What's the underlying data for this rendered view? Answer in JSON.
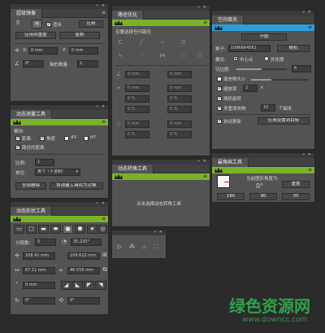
{
  "theme": {
    "accent_green": "#7cb22a",
    "accent_blue": "#2aa0d8",
    "panel_bg": "#535353"
  },
  "align_panel": {
    "title": "超级镜像",
    "checkbox_label": "适合",
    "apply_label": "应用",
    "btn_reset": "应用到重置",
    "btn_copy": "复制",
    "x_label": "X:",
    "x_value": "0 mm",
    "y_label": "Y:",
    "y_value": "0 mm",
    "angle_value": "0°",
    "axis_count_label": "轴的数量:",
    "axis_count_value": "2"
  },
  "measure_panel": {
    "title": "动态测量工具",
    "section_label": "模块:",
    "opt_distance": "距离",
    "opt_angle": "角度",
    "opt_dx": "dX",
    "opt_dy": "dY",
    "opt_path_distance": "路径的距离",
    "scale_label": "比例:",
    "scale_value": "1",
    "unit_label": "单位:",
    "unit_value": "英寸（十进制）",
    "btn_delete_all": "全部删除",
    "btn_convert": "将测量工具转为对象"
  },
  "shape_panel": {
    "title": "动态形状工具",
    "segments_label": "分段数:",
    "segments_value": "5",
    "angle_value": "35.235°",
    "x_value": "108.41 mm",
    "y_value": "109.612 mm",
    "w_value": "67.11 mm",
    "h_value": "46.555 mm",
    "corner_value": "0 mm",
    "rot_value": "0°",
    "skew_value": "0°"
  },
  "path_panel": {
    "title": "路径优化",
    "hint": "仅要选择任何路径",
    "field_value": "0 mm",
    "pct_value": "0 %"
  },
  "corner_panel": {
    "title": "动态转角工具",
    "hint": "点击选择动态转角工具"
  },
  "fill_panel": {
    "title": "空间填充",
    "btn_fill": "开始",
    "seed_label": "种子:",
    "seed_value": "1096664561",
    "btn_random": "随机",
    "mode_label": "模式:",
    "mode_center": "中心点",
    "mode_outline": "外轮廓",
    "count_label": "切边度:",
    "count_value": "6",
    "fill_size_label": "填充物大小",
    "scale_label": "缩放率",
    "scale_value": "2",
    "random_rotate_label": "随机旋转",
    "multi_fill_label": "多重填充物",
    "multi_count": "10",
    "multi_unit": "个副本",
    "auto_update_label": "自动更新",
    "btn_apply_target": "应用设置到目标"
  },
  "angle_panel": {
    "title": "最角画工具",
    "current_label": "当前图形角度为:",
    "current_value": "0°",
    "btn_reset": "重置",
    "btn_180": "180",
    "btn_90": "90",
    "btn_30": "30"
  },
  "watermark": {
    "cn": "绿色资源网",
    "url": "www.downcc.com"
  }
}
